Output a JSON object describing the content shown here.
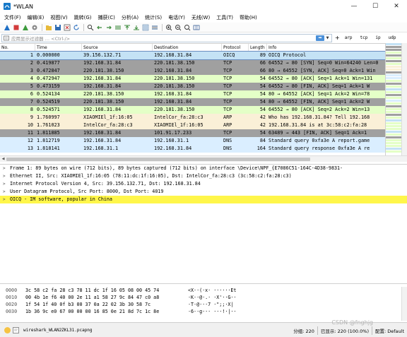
{
  "window": {
    "title": "*WLAN",
    "controls": [
      "—",
      "☐",
      "✕"
    ]
  },
  "menu": [
    "文件(F)",
    "编辑(E)",
    "视图(V)",
    "跳转(G)",
    "捕获(C)",
    "分析(A)",
    "统计(S)",
    "电话(Y)",
    "无线(W)",
    "工具(T)",
    "帮助(H)"
  ],
  "toolbar_icons": [
    "shark-fin-start-icon",
    "stop-icon",
    "restart-icon",
    "options-gear-icon",
    "open-file-icon",
    "save-file-icon",
    "close-file-icon",
    "reload-icon",
    "find-icon",
    "back-arrow-icon",
    "forward-arrow-icon",
    "go-to-packet-icon",
    "first-packet-icon",
    "last-packet-icon",
    "auto-scroll-icon",
    "colorize-icon",
    "zoom-in-icon",
    "zoom-out-icon",
    "zoom-reset-icon",
    "resize-columns-icon"
  ],
  "filter": {
    "placeholder": "应用显示过滤器 … <Ctrl-/>",
    "apply_label": "➡",
    "quick_filters": [
      "arp",
      "tcp",
      "ip",
      "udp"
    ]
  },
  "packet_list": {
    "columns": [
      "No.",
      "Time",
      "Source",
      "Destination",
      "Protocol",
      "Length",
      "Info"
    ],
    "rows": [
      {
        "no": "1",
        "time": "0.000000",
        "src": "39.156.132.71",
        "dst": "192.168.31.84",
        "proto": "OICQ",
        "len": "89",
        "info": "OICQ Protocol",
        "bg": "#c4e2f5",
        "selected": true
      },
      {
        "no": "2",
        "time": "0.419877",
        "src": "192.168.31.84",
        "dst": "220.181.38.150",
        "proto": "TCP",
        "len": "66",
        "info": "64552 → 80 [SYN] Seq=0 Win=64240 Len=0",
        "bg": "#a0a0a0"
      },
      {
        "no": "3",
        "time": "0.472847",
        "src": "220.181.38.150",
        "dst": "192.168.31.84",
        "proto": "TCP",
        "len": "66",
        "info": "80 → 64552 [SYN, ACK] Seq=0 Ack=1 Win",
        "bg": "#a0a0a0"
      },
      {
        "no": "4",
        "time": "0.472947",
        "src": "192.168.31.84",
        "dst": "220.181.38.150",
        "proto": "TCP",
        "len": "54",
        "info": "64552 → 80 [ACK] Seq=1 Ack=1 Win=131",
        "bg": "#e4ffc7"
      },
      {
        "no": "5",
        "time": "0.473159",
        "src": "192.168.31.84",
        "dst": "220.181.38.150",
        "proto": "TCP",
        "len": "54",
        "info": "64552 → 80 [FIN, ACK] Seq=1 Ack=1 W",
        "bg": "#a0a0a0"
      },
      {
        "no": "6",
        "time": "0.524134",
        "src": "220.181.38.150",
        "dst": "192.168.31.84",
        "proto": "TCP",
        "len": "54",
        "info": "80 → 64552 [ACK] Seq=1 Ack=2 Win=78",
        "bg": "#e4ffc7"
      },
      {
        "no": "7",
        "time": "0.524519",
        "src": "220.181.38.150",
        "dst": "192.168.31.84",
        "proto": "TCP",
        "len": "54",
        "info": "80 → 64552 [FIN, ACK] Seq=1 Ack=2 W",
        "bg": "#a0a0a0"
      },
      {
        "no": "8",
        "time": "0.524571",
        "src": "192.168.31.84",
        "dst": "220.181.38.150",
        "proto": "TCP",
        "len": "54",
        "info": "64552 → 80 [ACK] Seq=2 Ack=2 Win=13",
        "bg": "#e4ffc7"
      },
      {
        "no": "9",
        "time": "1.760997",
        "src": "XIAOMIEl_1f:16:05",
        "dst": "IntelCor_fa:28:c3",
        "proto": "ARP",
        "len": "42",
        "info": "Who has 192.168.31.84? Tell 192.168",
        "bg": "#faf0d7"
      },
      {
        "no": "10",
        "time": "1.761023",
        "src": "IntelCor_fa:28:c3",
        "dst": "XIAOMIEl_1f:16:05",
        "proto": "ARP",
        "len": "42",
        "info": "192.168.31.84 is at 3c:58:c2:fa:28",
        "bg": "#faf0d7"
      },
      {
        "no": "11",
        "time": "1.811885",
        "src": "192.168.31.84",
        "dst": "101.91.17.233",
        "proto": "TCP",
        "len": "54",
        "info": "63489 → 443 [FIN, ACK] Seq=1 Ack=1",
        "bg": "#a0a0a0"
      },
      {
        "no": "12",
        "time": "1.812719",
        "src": "192.168.31.84",
        "dst": "192.168.31.1",
        "proto": "DNS",
        "len": "84",
        "info": "Standard query 0xfa3e A report.game",
        "bg": "#daeeff"
      },
      {
        "no": "13",
        "time": "1.818141",
        "src": "192.168.31.1",
        "dst": "192.168.31.84",
        "proto": "DNS",
        "len": "164",
        "info": "Standard query response 0xfa3e A re",
        "bg": "#daeeff"
      }
    ]
  },
  "minimap_colors": [
    "#c4e2f5",
    "#a0a0a0",
    "#a0a0a0",
    "#e4ffc7",
    "#a0a0a0",
    "#e4ffc7",
    "#a0a0a0",
    "#e4ffc7",
    "#faf0d7",
    "#faf0d7",
    "#a0a0a0",
    "#daeeff",
    "#daeeff",
    "#e4ffc7",
    "#a0a0a0",
    "#e4ffc7",
    "#c4e2f5",
    "#e4ffc7",
    "#a0a0a0",
    "#e4ffc7",
    "#daeeff",
    "#e4ffc7",
    "#a0a0a0",
    "#e4ffc7",
    "#e4ffc7",
    "#a0a0a0",
    "#e4ffc7",
    "#c4e2f5",
    "#e4ffc7",
    "#e4ffc7",
    "#e4ffc7",
    "#c4e2f5",
    "#e4ffc7",
    "#a0a0a0",
    "#e4ffc7",
    "#e4ffc7",
    "#e4ffc7",
    "#c4e2f5",
    "#e4ffc7"
  ],
  "details": [
    {
      "text": "Frame 1: 89 bytes on wire (712 bits), 89 bytes captured (712 bits) on interface \\Device\\NPF_{E7086C51-164C-4D38-9831-",
      "highlight": false
    },
    {
      "text": "Ethernet II, Src: XIAOMIEl_1f:16:05 (78:11:dc:1f:16:05), Dst: IntelCor_fa:28:c3 (3c:58:c2:fa:28:c3)",
      "highlight": false
    },
    {
      "text": "Internet Protocol Version 4, Src: 39.156.132.71, Dst: 192.168.31.84",
      "highlight": false
    },
    {
      "text": "User Datagram Protocol, Src Port: 8000, Dst Port: 4019",
      "highlight": false
    },
    {
      "text": "OICQ - IM software, popular in China",
      "highlight": true
    }
  ],
  "bytes": [
    {
      "offset": "0000",
      "hex": "3c 58 c2 fa 28 c3 78 11  dc 1f 16 05 08 00 45 74",
      "ascii": "<X··(·x· ······Et"
    },
    {
      "offset": "0010",
      "hex": "00 4b 1e f6 40 00 2e 11  a1 58 27 9c 84 47 c0 a8",
      "ascii": "·K··@·.· ·X'··G··"
    },
    {
      "offset": "0020",
      "hex": "1f 54 1f 40 0f b3 00 37  0a 22 02 3b 30 58 7c",
      "ascii": "·T·@···7 ·\";;·X|"
    },
    {
      "offset": "0030",
      "hex": "1b 36 9c e0 67 00 00 00  16 85 0e 21 8d 7c 1c 8e",
      "ascii": "·6··g··· ···!·|··"
    }
  ],
  "status": {
    "file": "wireshark_WLAN2ZKL31.pcapng",
    "packets": "分组: 220",
    "displayed": "已显示: 220 (100.0%)",
    "profile": "配置: Default",
    "watermark": "CSDN @fnghjg"
  },
  "colors": {
    "selected_outline": "#6b8dbf",
    "highlight": "#fff64a",
    "status_ok": "#f6c343"
  }
}
